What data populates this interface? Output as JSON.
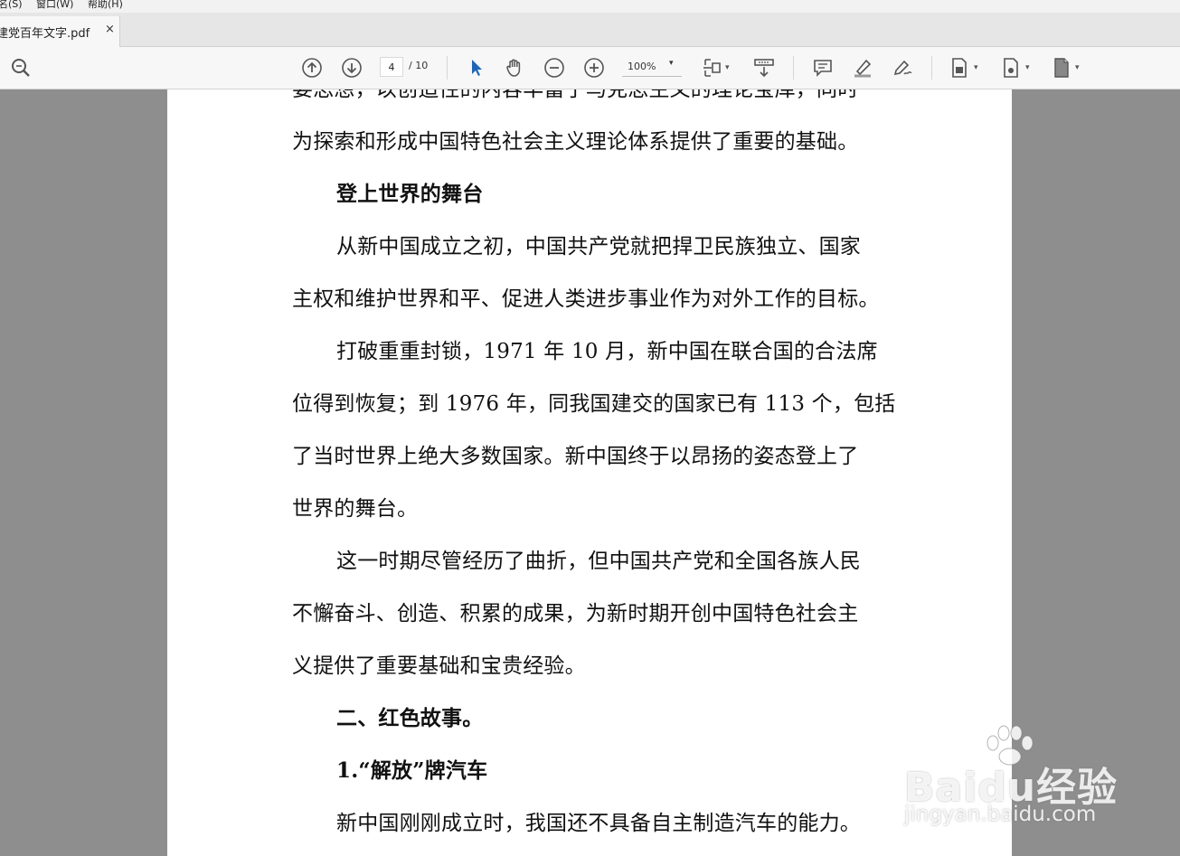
{
  "menubar": {
    "items": [
      {
        "label": "名(S)"
      },
      {
        "label": "窗口(W)"
      },
      {
        "label": "帮助(H)"
      }
    ]
  },
  "tab": {
    "title": "建党百年文字.pdf",
    "close": "×"
  },
  "toolbar": {
    "current_page": "4",
    "total_pages": "/ 10",
    "zoom": "100%",
    "zoom_caret": "▾",
    "caret": "▾",
    "icons": [
      "search-zoom-icon",
      "prev-page-icon",
      "next-page-icon",
      "select-arrow-icon",
      "hand-tool-icon",
      "zoom-out-icon",
      "zoom-in-icon",
      "fit-page-icon",
      "read-mode-icon",
      "comment-icon",
      "highlight-icon",
      "sign-icon",
      "page-tool-icon",
      "export-page-icon",
      "file-icon"
    ]
  },
  "document": {
    "lines": [
      {
        "text": "要思想，以创造性的内容丰富了马克思主义的理论宝库，同时",
        "bold": false
      },
      {
        "text": "为探索和形成中国特色社会主义理论体系提供了重要的基础。",
        "bold": false
      },
      {
        "text": "登上世界的舞台",
        "bold": true
      },
      {
        "text": "从新中国成立之初，中国共产党就把捍卫民族独立、国家",
        "bold": false
      },
      {
        "text": "主权和维护世界和平、促进人类进步事业作为对外工作的目标。",
        "bold": false
      },
      {
        "text": "打破重重封锁，1971 年 10 月，新中国在联合国的合法席",
        "bold": false
      },
      {
        "text": "位得到恢复；到 1976 年，同我国建交的国家已有 113 个，包括",
        "bold": false
      },
      {
        "text": "了当时世界上绝大多数国家。新中国终于以昂扬的姿态登上了",
        "bold": false
      },
      {
        "text": "世界的舞台。",
        "bold": false
      },
      {
        "text": "这一时期尽管经历了曲折，但中国共产党和全国各族人民",
        "bold": false
      },
      {
        "text": "不懈奋斗、创造、积累的成果，为新时期开创中国特色社会主",
        "bold": false
      },
      {
        "text": "义提供了重要基础和宝贵经验。",
        "bold": false
      },
      {
        "text": "二、红色故事。",
        "bold": true
      },
      {
        "text": "1.“解放”牌汽车",
        "bold": true
      },
      {
        "text": "新中国刚刚成立时，我国还不具备自主制造汽车的能力。",
        "bold": false
      }
    ]
  },
  "watermark": {
    "brand": "Baidu经验",
    "url": "jingyan.baidu.com"
  },
  "colors": {
    "accent_blue": "#1f66b5",
    "icon_gray": "#555555",
    "background_gray": "#8e8e8e"
  }
}
